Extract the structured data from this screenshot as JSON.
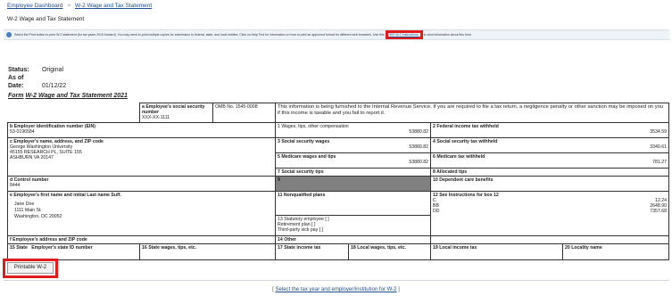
{
  "breadcrumb": {
    "home": "Employee Dashboard",
    "sep": ">",
    "current": "W-2 Wage and Tax Statement"
  },
  "page_title": "W-2 Wage and Tax Statement",
  "info_bar": {
    "text_before": "Select the Print button to print W-2 statement (for tax years 2015 forward). You may need to print multiple copies for submission to federal, state, and local entities. Click on Help Text for information on how to print an approved format for different web browsers. Use this",
    "link": "IRS W-2 Instructions",
    "text_after": "to view information about this form."
  },
  "status": {
    "status_label": "Status:",
    "status_value": "Original",
    "date_label": "As of Date:",
    "date_value": "01/12/22"
  },
  "form_title": {
    "prefix": "Form",
    "name": "W-2  Wage and Tax Statement  2021"
  },
  "w2": {
    "a_label": "a Employee's social security number",
    "a_value": "XXX-XX-1111",
    "omb": "OMB No. 1545-0008",
    "notice": "This information is being furnished to the Internal Revenue Service. If you are required to file a tax return, a negligence penalty or other sanction may be imposed on you if this income is taxable and you fail to report it.",
    "b_label": "b Employer identification number (EIN)",
    "b_value": "53-0196584",
    "box1_label": "1 Wages, tips, other compensation",
    "box1_value": "53880.82",
    "box2_label": "2 Federal income tax withheld",
    "box2_value": "3534.59",
    "c_label": "c Employer's name, address, and ZIP code",
    "c_line1": "George Washington University",
    "c_line2": "45155 RESEARCH PL, SUITE 155",
    "c_line3": "ASHBURN VA 20147",
    "box3_label": "3 Social security wages",
    "box3_value": "53880.82",
    "box4_label": "4 Social security tax withheld",
    "box4_value": "3340.61",
    "box5_label": "5 Medicare wages and tips",
    "box5_value": "53880.82",
    "box6_label": "6 Medicare tax withheld",
    "box6_value": "781.27",
    "box7_label": "7 Social security tips",
    "box8_label": "8 Allocated tips",
    "d_label": "d Control number",
    "d_value": "8444",
    "box9_label": "9",
    "box10_label": "10 Dependent care benefits",
    "e_label": "e Employee's first name and initial  Last name   Suff.",
    "e_line1": "Jane Doe",
    "e_line2": "1111 Main St.",
    "e_line3": "Washington, DC 20052",
    "box11_label": "11 Nonqualified plans",
    "box12_label": "12 See Instructions for box 12",
    "box12_c_code": "C",
    "box12_c_value": "12.24",
    "box12_bb_code": "BB",
    "box12_bb_value": "2648.90",
    "box12_dd_code": "DD",
    "box12_dd_value": "7357.68",
    "box13_line1": "13 Statutory employee [ ]",
    "box13_line2": "Retirement plan [ ]",
    "box13_line3": "Third-party sick pay [ ]",
    "f_label": "f Employee's address and ZIP code",
    "box14_label": "14 Other",
    "box15_label": "15 State",
    "box15b_label": "Employer's state ID number",
    "box16_label": "16 State wages, tips, etc.",
    "box17_label": "17 State income tax",
    "box18_label": "18 Local wages, tips, etc.",
    "box19_label": "19 Local income tax",
    "box20_label": "20 Locality name"
  },
  "print_button": "Printable W-2",
  "footer": {
    "bracket_open": "[",
    "link": "Select the tax year and employer/institution for W-2",
    "bracket_close": "]"
  },
  "colors": {
    "highlight": "#e21b1b",
    "link": "#1f4e8c",
    "shade": "#808080"
  }
}
